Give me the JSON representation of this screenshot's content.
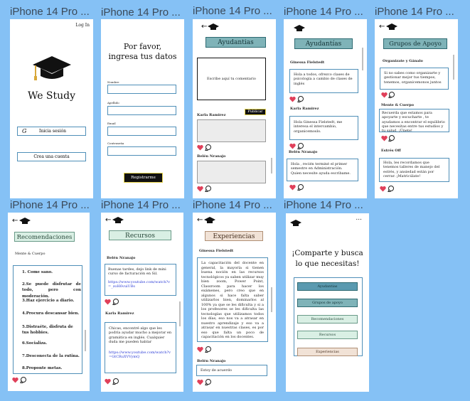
{
  "frame_title": "iPhone 14 Pro ...",
  "login": {
    "login_link": "Log In",
    "app_name": "We Study",
    "signin_icon": "G",
    "signin_label": "Inicia sesión",
    "create_label": "Crea una cuenta"
  },
  "register": {
    "title_line1": "Por favor,",
    "title_line2": "ingresa tus datos",
    "fields": [
      "Nombre",
      "Apellido",
      "Email",
      "Contraseña"
    ],
    "submit_label": "Registrarme"
  },
  "ayudantias_post": {
    "header": "Ayudantias",
    "compose_placeholder": "Escribe aquí tu comentario",
    "publish_label": "Publicar",
    "user1": "Karla Ramirez",
    "user2": "Belén Nranajo"
  },
  "ayudantias_feed": {
    "header": "Ayudantías",
    "posts": [
      {
        "user": "Ginessa Fielstedt",
        "text": "Hola a todos, ofrezco clases  de psicología  a cambio de clases de inglés"
      },
      {
        "user": "Karla Ramirez",
        "text": "Hola Ginessa Fielstedt, me interesa el intercambio, organicemoslo."
      },
      {
        "user": "Belén Nranajo",
        "text": "Hola , recién  terminé el primer semestre en Administración. Quien necesite ayuda escribame."
      }
    ]
  },
  "grupos": {
    "header": "Grupos de Apoyo",
    "posts": [
      {
        "user": "Organizate y Gánalo",
        "text": "Si no  sabes como organizarte y  gestionar mejor tus tiempos, tenemos, organicemonos juntos"
      },
      {
        "user": "Mente  & Cuerpo",
        "text": "Recuerda que estamos para apoyarte y escucharte , te ayudamos a encontrar el equilibrio que necesitas entre tus estudios y tu salud, ¡Únete!"
      },
      {
        "user": "Estrés Off",
        "text": "Hola, les recordamos que tenemos talleres de manejo del  estrés, y ansiedad están por cerrar. ¡Matricúlate!"
      }
    ]
  },
  "recomendaciones": {
    "header": "Recomendaciones",
    "user": "Mente  & Cuerpo",
    "items": [
      "1. Come sano.",
      "2.Se puede disfrutar de todo, pero con moderación.",
      "3.Haz ejercicio a diario.",
      "4.Procura descansar bien.",
      "5.Distraéte, disfruta de tus hobbies.",
      "6.Socializa.",
      "7.Desconecta de la rutina.",
      "8.Proponte metas."
    ]
  },
  "recursos": {
    "header": "Recursos",
    "posts": [
      {
        "user": "Belén Nranajo",
        "text": "Buenas tardes, dejo link de mini curso de facturación en Sil.",
        "link": "https://www.youtube.com/watch?v=_zoH6vuiUBs"
      },
      {
        "user": "Karla Ramirez",
        "text": "Chicas, encontré algo que les podría ayudar mucho a mejorar en gramática en inglés. Cualquier duda me pueden hablar",
        "link": "https://www.youtube.com/watch?v=GtCRuXVVymQ"
      }
    ]
  },
  "experiencias": {
    "header": "Experiencias",
    "user1": "Ginessa Fielstedt",
    "text": "La capacitación del docente en general, la mayoría si tienen buena noción en las recursos tecnológicos ya saben utilizar muy bien zoom, Power Point, Classroom para hacer los exámenes, pero creo que en algunos si hace falta saber utilizarlos bien, dominarlos al 100% ya que se les dificulta y si a los profesores se les dificulta las tecnologías que utilizamos todos los días, eso nos va a atrasar en nuestro aprendizaje y eso va a atrasar en nuestras clases, es por eso que falta un poco de capacitación en los docentes.",
    "user2": "Belén Nranajo",
    "reply": "Estoy de acuerdo"
  },
  "menu": {
    "more_icon": "...",
    "heading": "¡Comparte y busca lo que necesitas!",
    "buttons": [
      "Ayudantias",
      "Grupos de apoyo",
      "Recomendaciones",
      "Recursos",
      "Experiencias"
    ]
  },
  "colors": {
    "background": "#85c1f5",
    "heart": "#e0405a",
    "accent": "#4f8fb8"
  }
}
